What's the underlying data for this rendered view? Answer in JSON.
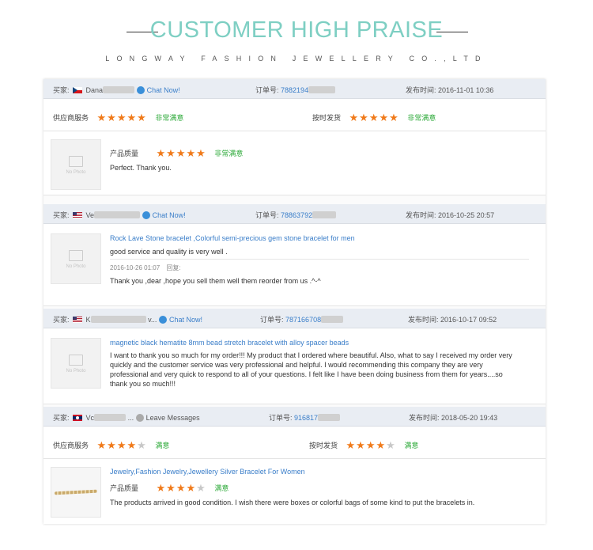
{
  "header": {
    "title": "CUSTOMER HIGH PRAISE",
    "subtitle": "LONGWAY FASHION JEWELLERY CO.,LTD"
  },
  "labels": {
    "buyer": "买家:",
    "order": "订单号:",
    "time": "发布时间:",
    "supplier_service": "供应商服务",
    "on_time_delivery": "按时发货",
    "product_quality": "产品质量",
    "no_photo": "No Photo",
    "reply": "回复:"
  },
  "reviews": [
    {
      "buyer_name": "Dana",
      "contact": "Chat Now!",
      "order_no": "7882194",
      "time": "2016-11-01 10:36",
      "supplier_rating": 5,
      "supplier_text": "非常满意",
      "delivery_rating": 5,
      "delivery_text": "非常满意",
      "quality_rating": 5,
      "quality_text": "非常满意",
      "comment": "Perfect. Thank you."
    },
    {
      "buyer_name": "Ve",
      "contact": "Chat Now!",
      "order_no": "78863792",
      "time": "2016-10-25 20:57",
      "product": "Rock Lave Stone bracelet ,Colorful semi-precious gem stone bracelet for men",
      "comment": "good service and quality is very well .",
      "reply_time": "2016-10-26 01:07",
      "reply_text": "Thank you ,dear ,hope you sell them well them reorder from us .^-^"
    },
    {
      "buyer_name": "K",
      "buyer_suffix": "v...",
      "contact": "Chat Now!",
      "order_no": "787166708",
      "time": "2016-10-17 09:52",
      "product": "magnetic black hematite 8mm bead stretch bracelet with alloy spacer beads",
      "comment_lines": [
        "I want to thank you so much for my order!!! My product that I ordered where beautiful. Also, what to say I received my order very",
        "quickly and the customer service was very professional and helpful. I would recommending this company they are very",
        "professional and very quick to respond to all of your questions. I felt like I have been doing business from them for years....so",
        "thank you so much!!!"
      ]
    },
    {
      "buyer_name": "Vc",
      "buyer_suffix": "...",
      "contact": "Leave Messages",
      "order_no": "916817",
      "time": "2018-05-20 19:43",
      "supplier_rating": 4,
      "supplier_text": "满意",
      "delivery_rating": 4,
      "delivery_text": "满意",
      "quality_rating": 4,
      "quality_text": "满意",
      "product": "Jewelry,Fashion Jewelry,Jewellery Silver Bracelet For Women",
      "comment": "The products arrived in good condition. I wish there were boxes or colorful bags of some kind to put the bracelets in."
    }
  ],
  "colors": {
    "accent": "#7ecfc3",
    "link": "#3a7ec9",
    "star": "#f07a1a",
    "satisfied": "#2eaa3a"
  }
}
